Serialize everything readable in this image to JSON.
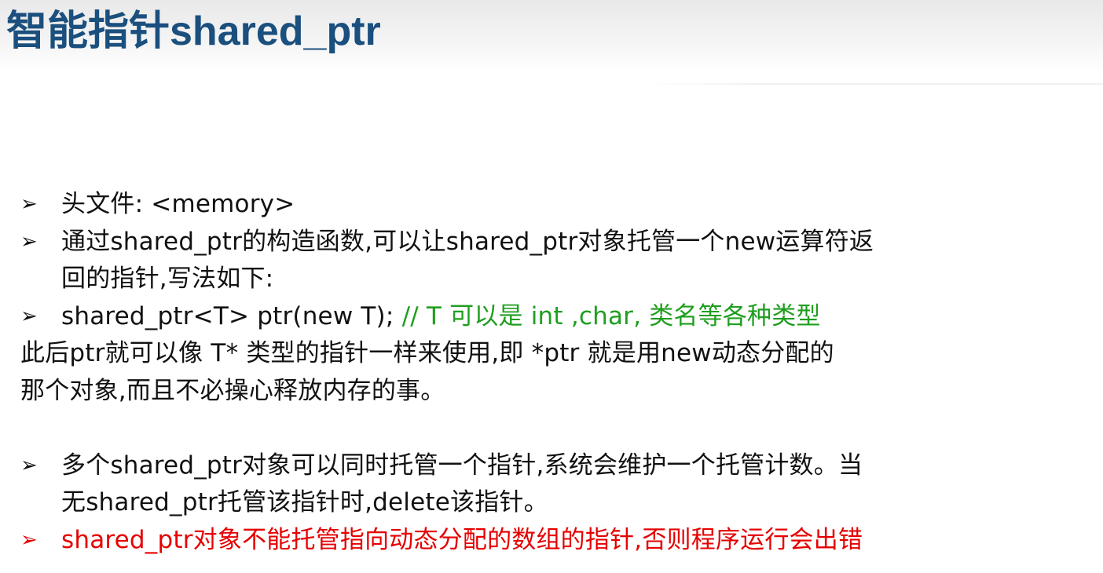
{
  "slide": {
    "title": "智能指针shared_ptr"
  },
  "content": {
    "bullet_symbol": "➢",
    "line1": "头文件: <memory>",
    "line2": "通过shared_ptr的构造函数,可以让shared_ptr对象托管一个new运算符返",
    "line2_cont": "回的指针,写法如下:",
    "line3_code": "shared_ptr<T> ptr(new T); ",
    "line3_comment": " // T 可以是 int ,char, 类名等各种类型",
    "line4": "此后ptr就可以像 T* 类型的指针一样来使用,即 *ptr 就是用new动态分配的",
    "line5": "那个对象,而且不必操心释放内存的事。",
    "line6": "多个shared_ptr对象可以同时托管一个指针,系统会维护一个托管计数。当",
    "line6_cont": "无shared_ptr托管该指针时,delete该指针。",
    "line7": "shared_ptr对象不能托管指向动态分配的数组的指针,否则程序运行会出错"
  },
  "colors": {
    "title": "#1a4f7e",
    "text": "#111111",
    "comment": "#1f9e1f",
    "warning": "#e60000"
  }
}
